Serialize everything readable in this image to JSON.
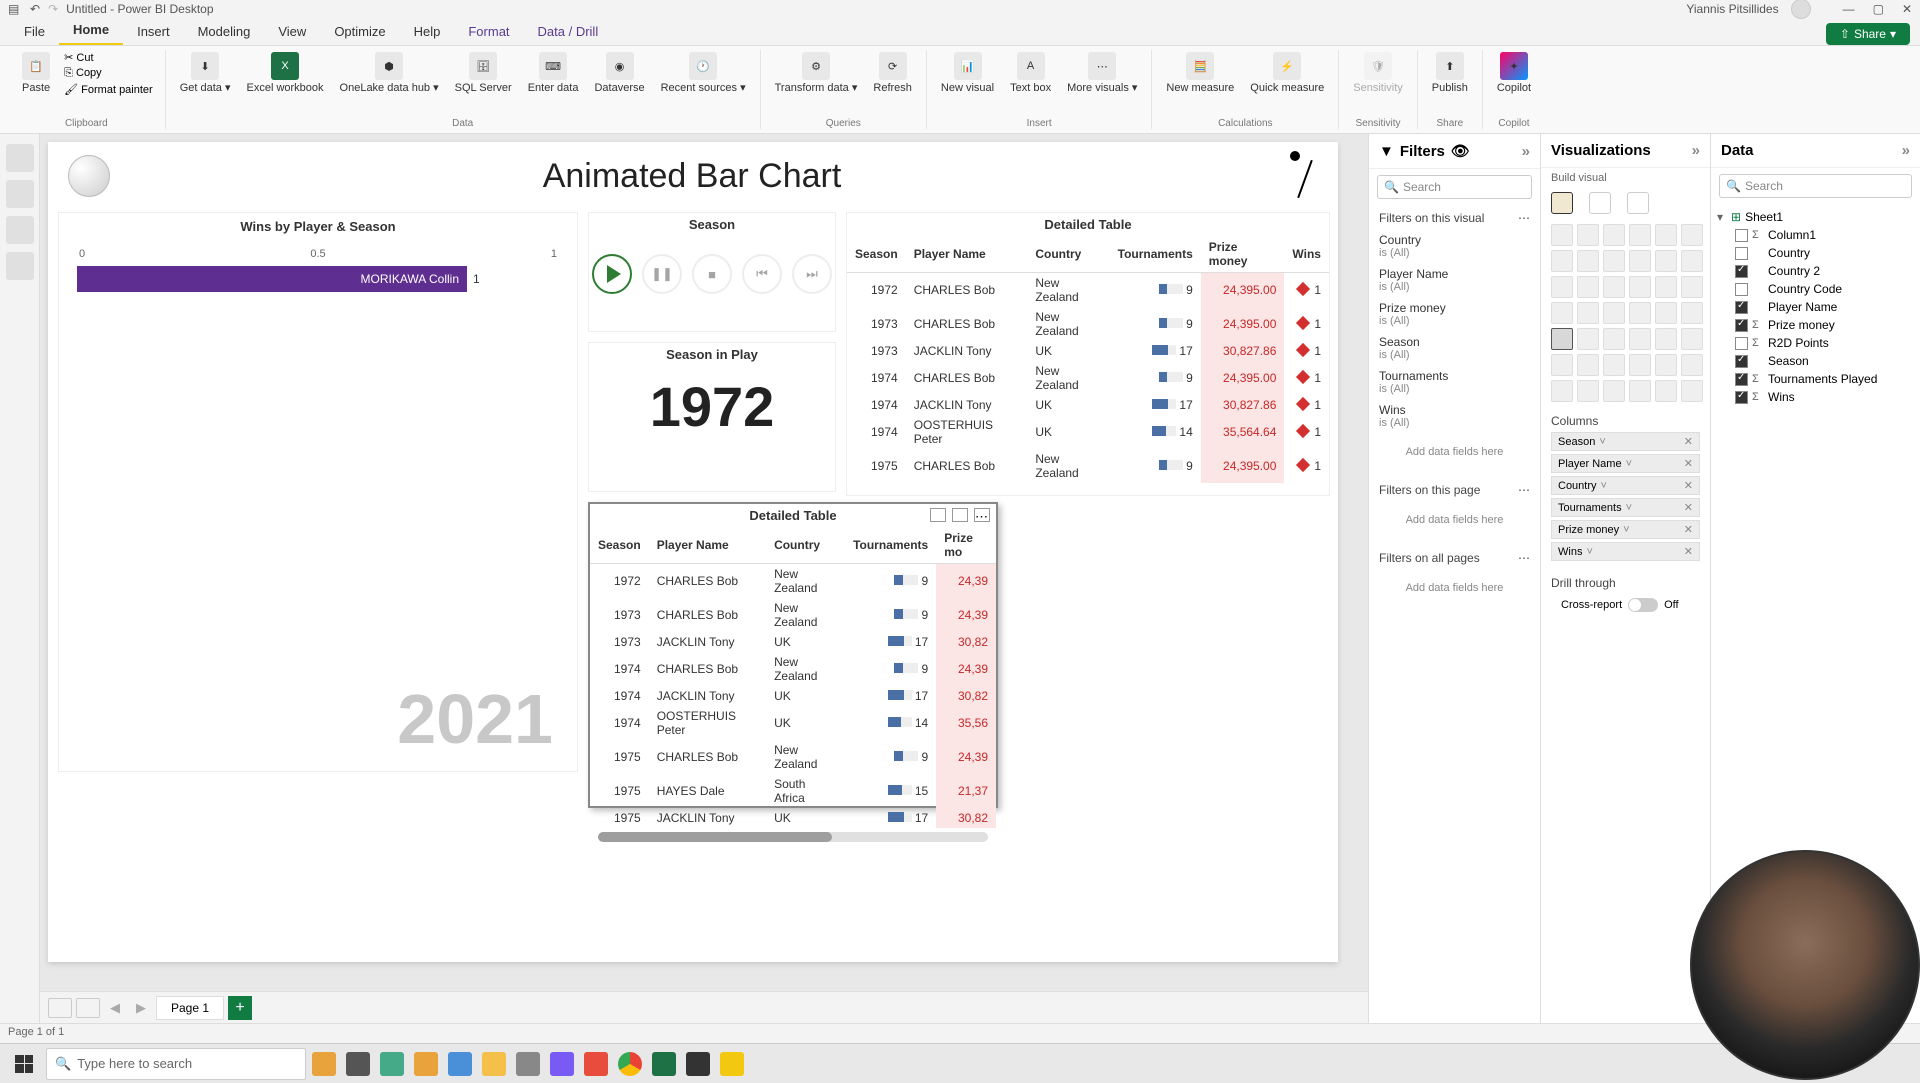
{
  "window": {
    "title": "Untitled - Power BI Desktop",
    "user": "Yiannis Pitsillides"
  },
  "ribbon_tabs": [
    "File",
    "Home",
    "Insert",
    "Modeling",
    "View",
    "Optimize",
    "Help",
    "Format",
    "Data / Drill"
  ],
  "ribbon_active": "Home",
  "share_label": "Share",
  "ribbon": {
    "clipboard": {
      "paste": "Paste",
      "cut": "Cut",
      "copy": "Copy",
      "format_painter": "Format painter",
      "group": "Clipboard"
    },
    "data": {
      "get": "Get data",
      "excel": "Excel workbook",
      "onelake": "OneLake data hub",
      "sql": "SQL Server",
      "enter": "Enter data",
      "dataverse": "Dataverse",
      "recent": "Recent sources",
      "group": "Data"
    },
    "queries": {
      "transform": "Transform data",
      "refresh": "Refresh",
      "group": "Queries"
    },
    "insert": {
      "new_visual": "New visual",
      "text": "Text box",
      "more": "More visuals",
      "group": "Insert"
    },
    "calc": {
      "new_measure": "New measure",
      "quick": "Quick measure",
      "group": "Calculations"
    },
    "sens": {
      "label": "Sensitivity",
      "group": "Sensitivity"
    },
    "share": {
      "publish": "Publish",
      "group": "Share"
    },
    "copilot": {
      "label": "Copilot",
      "group": "Copilot"
    }
  },
  "canvas": {
    "title": "Animated Bar Chart",
    "bar": {
      "title": "Wins by Player & Season",
      "axis": [
        "0",
        "0.5",
        "1"
      ],
      "bar_label": "MORIKAWA Collin",
      "bar_value": "1",
      "year": "2021"
    },
    "season": {
      "title": "Season"
    },
    "season_play": {
      "title": "Season in Play",
      "year": "1972"
    },
    "table1": {
      "title": "Detailed Table",
      "cols": [
        "Season",
        "Player Name",
        "Country",
        "Tournaments",
        "Prize money",
        "Wins"
      ],
      "rows": [
        {
          "season": "1972",
          "player": "CHARLES Bob",
          "country": "New Zealand",
          "tourn": "9",
          "money": "24,395.00",
          "wins": "1"
        },
        {
          "season": "1973",
          "player": "CHARLES Bob",
          "country": "New Zealand",
          "tourn": "9",
          "money": "24,395.00",
          "wins": "1"
        },
        {
          "season": "1973",
          "player": "JACKLIN Tony",
          "country": "UK",
          "tourn": "17",
          "money": "30,827.86",
          "wins": "1"
        },
        {
          "season": "1974",
          "player": "CHARLES Bob",
          "country": "New Zealand",
          "tourn": "9",
          "money": "24,395.00",
          "wins": "1"
        },
        {
          "season": "1974",
          "player": "JACKLIN Tony",
          "country": "UK",
          "tourn": "17",
          "money": "30,827.86",
          "wins": "1"
        },
        {
          "season": "1974",
          "player": "OOSTERHUIS Peter",
          "country": "UK",
          "tourn": "14",
          "money": "35,564.64",
          "wins": "1"
        },
        {
          "season": "1975",
          "player": "CHARLES Bob",
          "country": "New Zealand",
          "tourn": "9",
          "money": "24,395.00",
          "wins": "1"
        }
      ]
    },
    "table2": {
      "title": "Detailed Table",
      "cols": [
        "Season",
        "Player Name",
        "Country",
        "Tournaments",
        "Prize mo"
      ],
      "rows": [
        {
          "season": "1972",
          "player": "CHARLES Bob",
          "country": "New Zealand",
          "tourn": "9",
          "money": "24,39"
        },
        {
          "season": "1973",
          "player": "CHARLES Bob",
          "country": "New Zealand",
          "tourn": "9",
          "money": "24,39"
        },
        {
          "season": "1973",
          "player": "JACKLIN Tony",
          "country": "UK",
          "tourn": "17",
          "money": "30,82"
        },
        {
          "season": "1974",
          "player": "CHARLES Bob",
          "country": "New Zealand",
          "tourn": "9",
          "money": "24,39"
        },
        {
          "season": "1974",
          "player": "JACKLIN Tony",
          "country": "UK",
          "tourn": "17",
          "money": "30,82"
        },
        {
          "season": "1974",
          "player": "OOSTERHUIS Peter",
          "country": "UK",
          "tourn": "14",
          "money": "35,56"
        },
        {
          "season": "1975",
          "player": "CHARLES Bob",
          "country": "New Zealand",
          "tourn": "9",
          "money": "24,39"
        },
        {
          "season": "1975",
          "player": "HAYES Dale",
          "country": "South Africa",
          "tourn": "15",
          "money": "21,37"
        },
        {
          "season": "1975",
          "player": "JACKLIN Tony",
          "country": "UK",
          "tourn": "17",
          "money": "30,82"
        }
      ]
    }
  },
  "filters": {
    "title": "Filters",
    "search_placeholder": "Search",
    "on_visual": "Filters on this visual",
    "on_page": "Filters on this page",
    "on_all": "Filters on all pages",
    "add": "Add data fields here",
    "items": [
      {
        "name": "Country",
        "val": "is (All)"
      },
      {
        "name": "Player Name",
        "val": "is (All)"
      },
      {
        "name": "Prize money",
        "val": "is (All)"
      },
      {
        "name": "Season",
        "val": "is (All)"
      },
      {
        "name": "Tournaments",
        "val": "is (All)"
      },
      {
        "name": "Wins",
        "val": "is (All)"
      }
    ]
  },
  "viz": {
    "title": "Visualizations",
    "sub": "Build visual",
    "columns_label": "Columns",
    "columns": [
      "Season",
      "Player Name",
      "Country",
      "Tournaments",
      "Prize money",
      "Wins"
    ],
    "drill": "Drill through",
    "cross": "Cross-report",
    "off": "Off"
  },
  "data_pane": {
    "title": "Data",
    "search_placeholder": "Search",
    "table": "Sheet1",
    "fields": [
      {
        "name": "Column1",
        "checked": false,
        "sigma": true
      },
      {
        "name": "Country",
        "checked": false,
        "sigma": false
      },
      {
        "name": "Country 2",
        "checked": true,
        "sigma": false
      },
      {
        "name": "Country Code",
        "checked": false,
        "sigma": false
      },
      {
        "name": "Player Name",
        "checked": true,
        "sigma": false
      },
      {
        "name": "Prize money",
        "checked": true,
        "sigma": true
      },
      {
        "name": "R2D Points",
        "checked": false,
        "sigma": true
      },
      {
        "name": "Season",
        "checked": true,
        "sigma": false
      },
      {
        "name": "Tournaments Played",
        "checked": true,
        "sigma": true
      },
      {
        "name": "Wins",
        "checked": true,
        "sigma": true
      }
    ]
  },
  "page": {
    "tab": "Page 1",
    "status": "Page 1 of 1"
  },
  "taskbar": {
    "search": "Type here to search"
  },
  "chart_data": {
    "type": "bar",
    "title": "Wins by Player & Season",
    "categories": [
      "MORIKAWA Collin"
    ],
    "values": [
      1
    ],
    "xlabel": "",
    "ylabel": "",
    "xlim": [
      0,
      1
    ]
  }
}
